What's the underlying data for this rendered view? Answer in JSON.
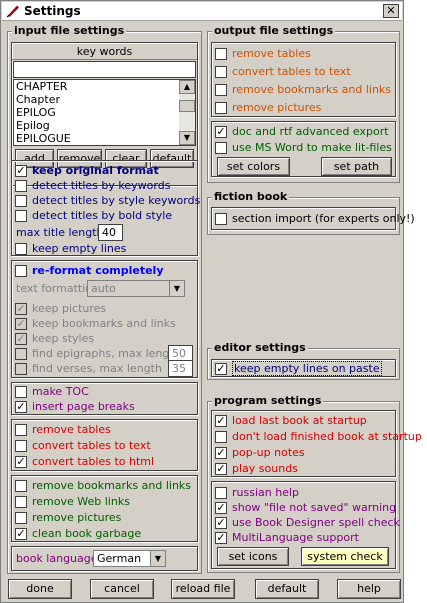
{
  "title": "Settings",
  "input": {
    "title": "input file settings",
    "keywords_label": "key words",
    "keywords_input": "",
    "keywords": [
      "CHAPTER",
      "Chapter",
      "EPILOG",
      "Epilog",
      "EPILOGUE"
    ],
    "btn_add": "add",
    "btn_remove": "remove",
    "btn_clear": "clear",
    "btn_default": "default",
    "keep_original": "keep original format",
    "detect_keywords": "detect titles by keywords",
    "detect_style": "detect titles by style keywords",
    "detect_bold": "detect titles by bold style",
    "max_title_label": "max title length",
    "max_title_value": "40",
    "keep_empty": "keep empty lines",
    "reformat": "re-format completely",
    "text_formatting_label": "text formatting",
    "text_formatting_value": "auto",
    "keep_pictures": "keep pictures",
    "keep_bookmarks_links": "keep bookmarks and links",
    "keep_styles": "keep styles",
    "find_epigraphs": "find epigraphs, max length",
    "epigraphs_value": "50",
    "find_verses": "find verses, max length",
    "verses_value": "35",
    "make_toc": "make TOC",
    "insert_breaks": "insert page breaks",
    "remove_tables": "remove tables",
    "convert_tables_text": "convert tables to text",
    "convert_tables_html": "convert tables to html",
    "remove_bookmarks": "remove bookmarks and links",
    "remove_web": "remove Web links",
    "remove_pictures": "remove pictures",
    "clean_garbage": "clean book garbage",
    "book_language_label": "book language",
    "book_language_value": "German"
  },
  "output": {
    "title": "output file settings",
    "remove_tables": "remove tables",
    "convert_tables": "convert tables to text",
    "remove_bookmarks": "remove bookmarks and links",
    "remove_pictures": "remove pictures",
    "doc_rtf": "doc and rtf advanced export",
    "ms_word": "use MS Word to make lit-files",
    "btn_set_colors": "set colors",
    "btn_set_path": "set path"
  },
  "fiction": {
    "title": "fiction book",
    "section_import": "section import (for experts only!)"
  },
  "editor": {
    "title": "editor settings",
    "keep_empty": "keep empty lines on paste"
  },
  "program": {
    "title": "program settings",
    "load_last": "load last book at startup",
    "dont_load": "don't load finished book at startup",
    "popup_notes": "pop-up notes",
    "play_sounds": "play sounds",
    "russian_help": "russian help",
    "show_warning": "show \"file not saved\" warning",
    "spell_check": "use Book Designer spell check",
    "multilang": "MultiLanguage support",
    "btn_set_icons": "set icons",
    "btn_system_check": "system check"
  },
  "footer": {
    "done": "done",
    "cancel": "cancel",
    "reload": "reload file",
    "default": "default",
    "help": "help"
  },
  "colors": {
    "window_bg": "#d4d0c8",
    "system_check_bg": "#ffffc0"
  }
}
